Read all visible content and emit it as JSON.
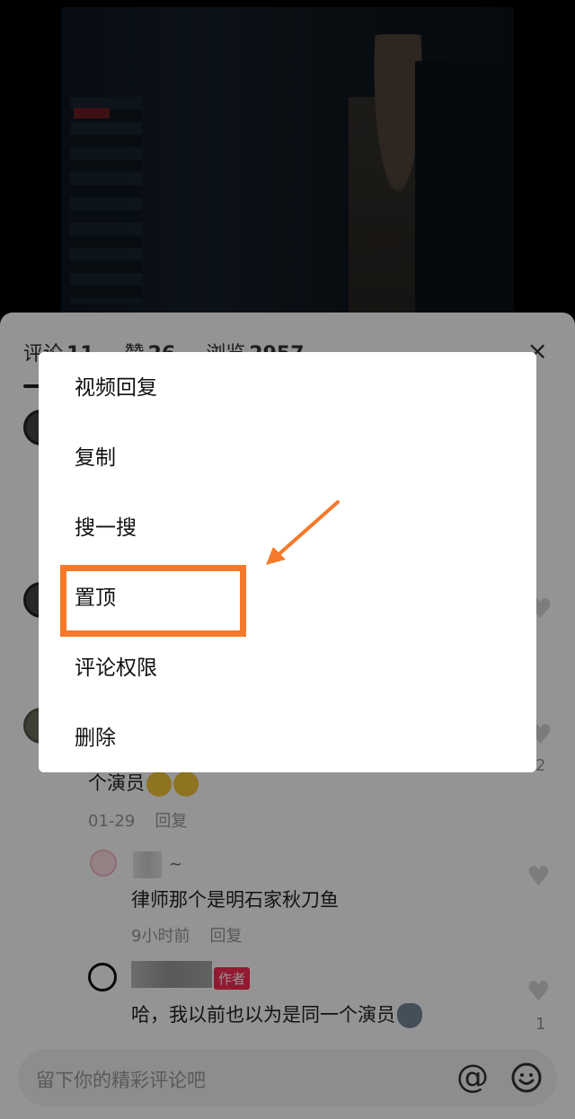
{
  "header": {
    "tabs": [
      {
        "label": "评论",
        "count": "11"
      },
      {
        "label": "赞",
        "count": "26"
      },
      {
        "label": "浏览",
        "count": "2957"
      }
    ],
    "close_label": "×"
  },
  "comments": [
    {
      "text": "个演员",
      "date": "01-29",
      "reply_label": "回复",
      "likes": "2"
    }
  ],
  "replies": [
    {
      "name_suffix": "~",
      "text": "律师那个是明石家秋刀鱼",
      "time": "9小时前",
      "reply_label": "回复"
    },
    {
      "badge": "作者",
      "text": "哈，我以前也以为是同一个演员",
      "likes": "1"
    }
  ],
  "input": {
    "placeholder": "留下你的精彩评论吧"
  },
  "menu": {
    "items": [
      "视频回复",
      "复制",
      "搜一搜",
      "置顶",
      "评论权限",
      "删除"
    ],
    "highlighted_index": 3
  },
  "colors": {
    "accent": "#f5792a",
    "author_badge": "#fe2c55"
  }
}
